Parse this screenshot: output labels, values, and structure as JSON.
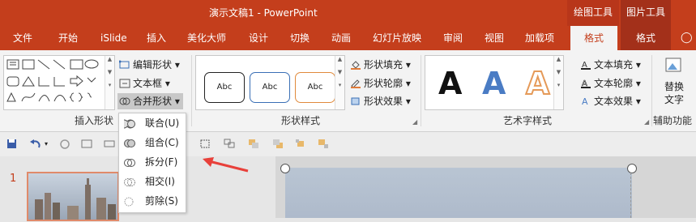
{
  "title_bar": {
    "title": "演示文稿1  -  PowerPoint",
    "context_tabs": [
      "绘图工具",
      "图片工具"
    ]
  },
  "tabs": [
    "文件",
    "开始",
    "iSlide",
    "插入",
    "美化大师",
    "设计",
    "切换",
    "动画",
    "幻灯片放映",
    "审阅",
    "视图",
    "加载项",
    "格式",
    "格式"
  ],
  "active_tab": "格式",
  "groups": {
    "insert_shapes": {
      "label": "插入形状",
      "buttons": {
        "edit_shape": "编辑形状",
        "text_box": "文本框",
        "merge_shapes": "合并形状"
      }
    },
    "shape_styles": {
      "label": "形状样式",
      "style_sample": "Abc",
      "buttons": {
        "fill": "形状填充",
        "outline": "形状轮廓",
        "effects": "形状效果"
      }
    },
    "wordart_styles": {
      "label": "艺术字样式",
      "sample_letter": "A",
      "buttons": {
        "text_fill": "文本填充",
        "text_outline": "文本轮廓",
        "text_effects": "文本效果"
      }
    },
    "accessibility": {
      "label": "辅助功能",
      "button_line1": "替换",
      "button_line2": "文字"
    }
  },
  "merge_menu": {
    "items": [
      {
        "label": "联合(U)",
        "icon": "union-icon"
      },
      {
        "label": "组合(C)",
        "icon": "combine-icon"
      },
      {
        "label": "拆分(F)",
        "icon": "fragment-icon"
      },
      {
        "label": "相交(I)",
        "icon": "intersect-icon"
      },
      {
        "label": "剪除(S)",
        "icon": "subtract-icon"
      }
    ]
  },
  "slide_pane": {
    "slide_number": "1"
  },
  "colors": {
    "accent": "#c43e1c",
    "arrow": "#e8403a"
  }
}
